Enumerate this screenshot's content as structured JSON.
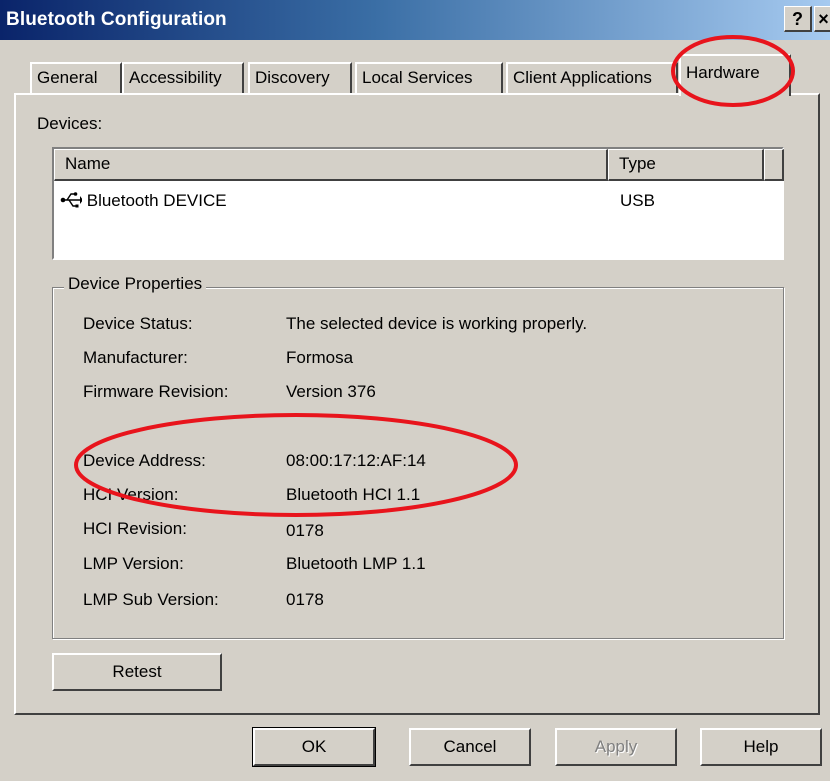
{
  "window": {
    "title": "Bluetooth Configuration",
    "help_label": "?",
    "close_label": "×"
  },
  "tabs": [
    {
      "label": "General"
    },
    {
      "label": "Accessibility"
    },
    {
      "label": "Discovery"
    },
    {
      "label": "Local Services"
    },
    {
      "label": "Client Applications"
    },
    {
      "label": "Hardware",
      "active": true
    }
  ],
  "devices": {
    "label": "Devices:",
    "columns": [
      "Name",
      "Type"
    ],
    "rows": [
      {
        "name": "Bluetooth DEVICE",
        "type": "USB",
        "icon": "usb-icon"
      }
    ]
  },
  "properties": {
    "title": "Device Properties",
    "items": [
      {
        "label": "Device Status:",
        "value": "The selected device is working properly."
      },
      {
        "label": "Manufacturer:",
        "value": "Formosa"
      },
      {
        "label": "Firmware Revision:",
        "value": "Version 376"
      },
      {
        "label": "Device Address:",
        "value": "08:00:17:12:AF:14"
      },
      {
        "label": "HCI Version:",
        "value": "Bluetooth HCI 1.1"
      },
      {
        "label": "HCI Revision:",
        "value": "0178"
      },
      {
        "label": "LMP Version:",
        "value": "Bluetooth LMP 1.1"
      },
      {
        "label": "LMP Sub Version:",
        "value": "0178"
      }
    ]
  },
  "buttons": {
    "retest": "Retest",
    "ok": "OK",
    "cancel": "Cancel",
    "apply": "Apply",
    "help": "Help"
  },
  "colors": {
    "annotation": "#e8141c",
    "titlebar_start": "#0a246a",
    "face": "#d4d0c8"
  }
}
